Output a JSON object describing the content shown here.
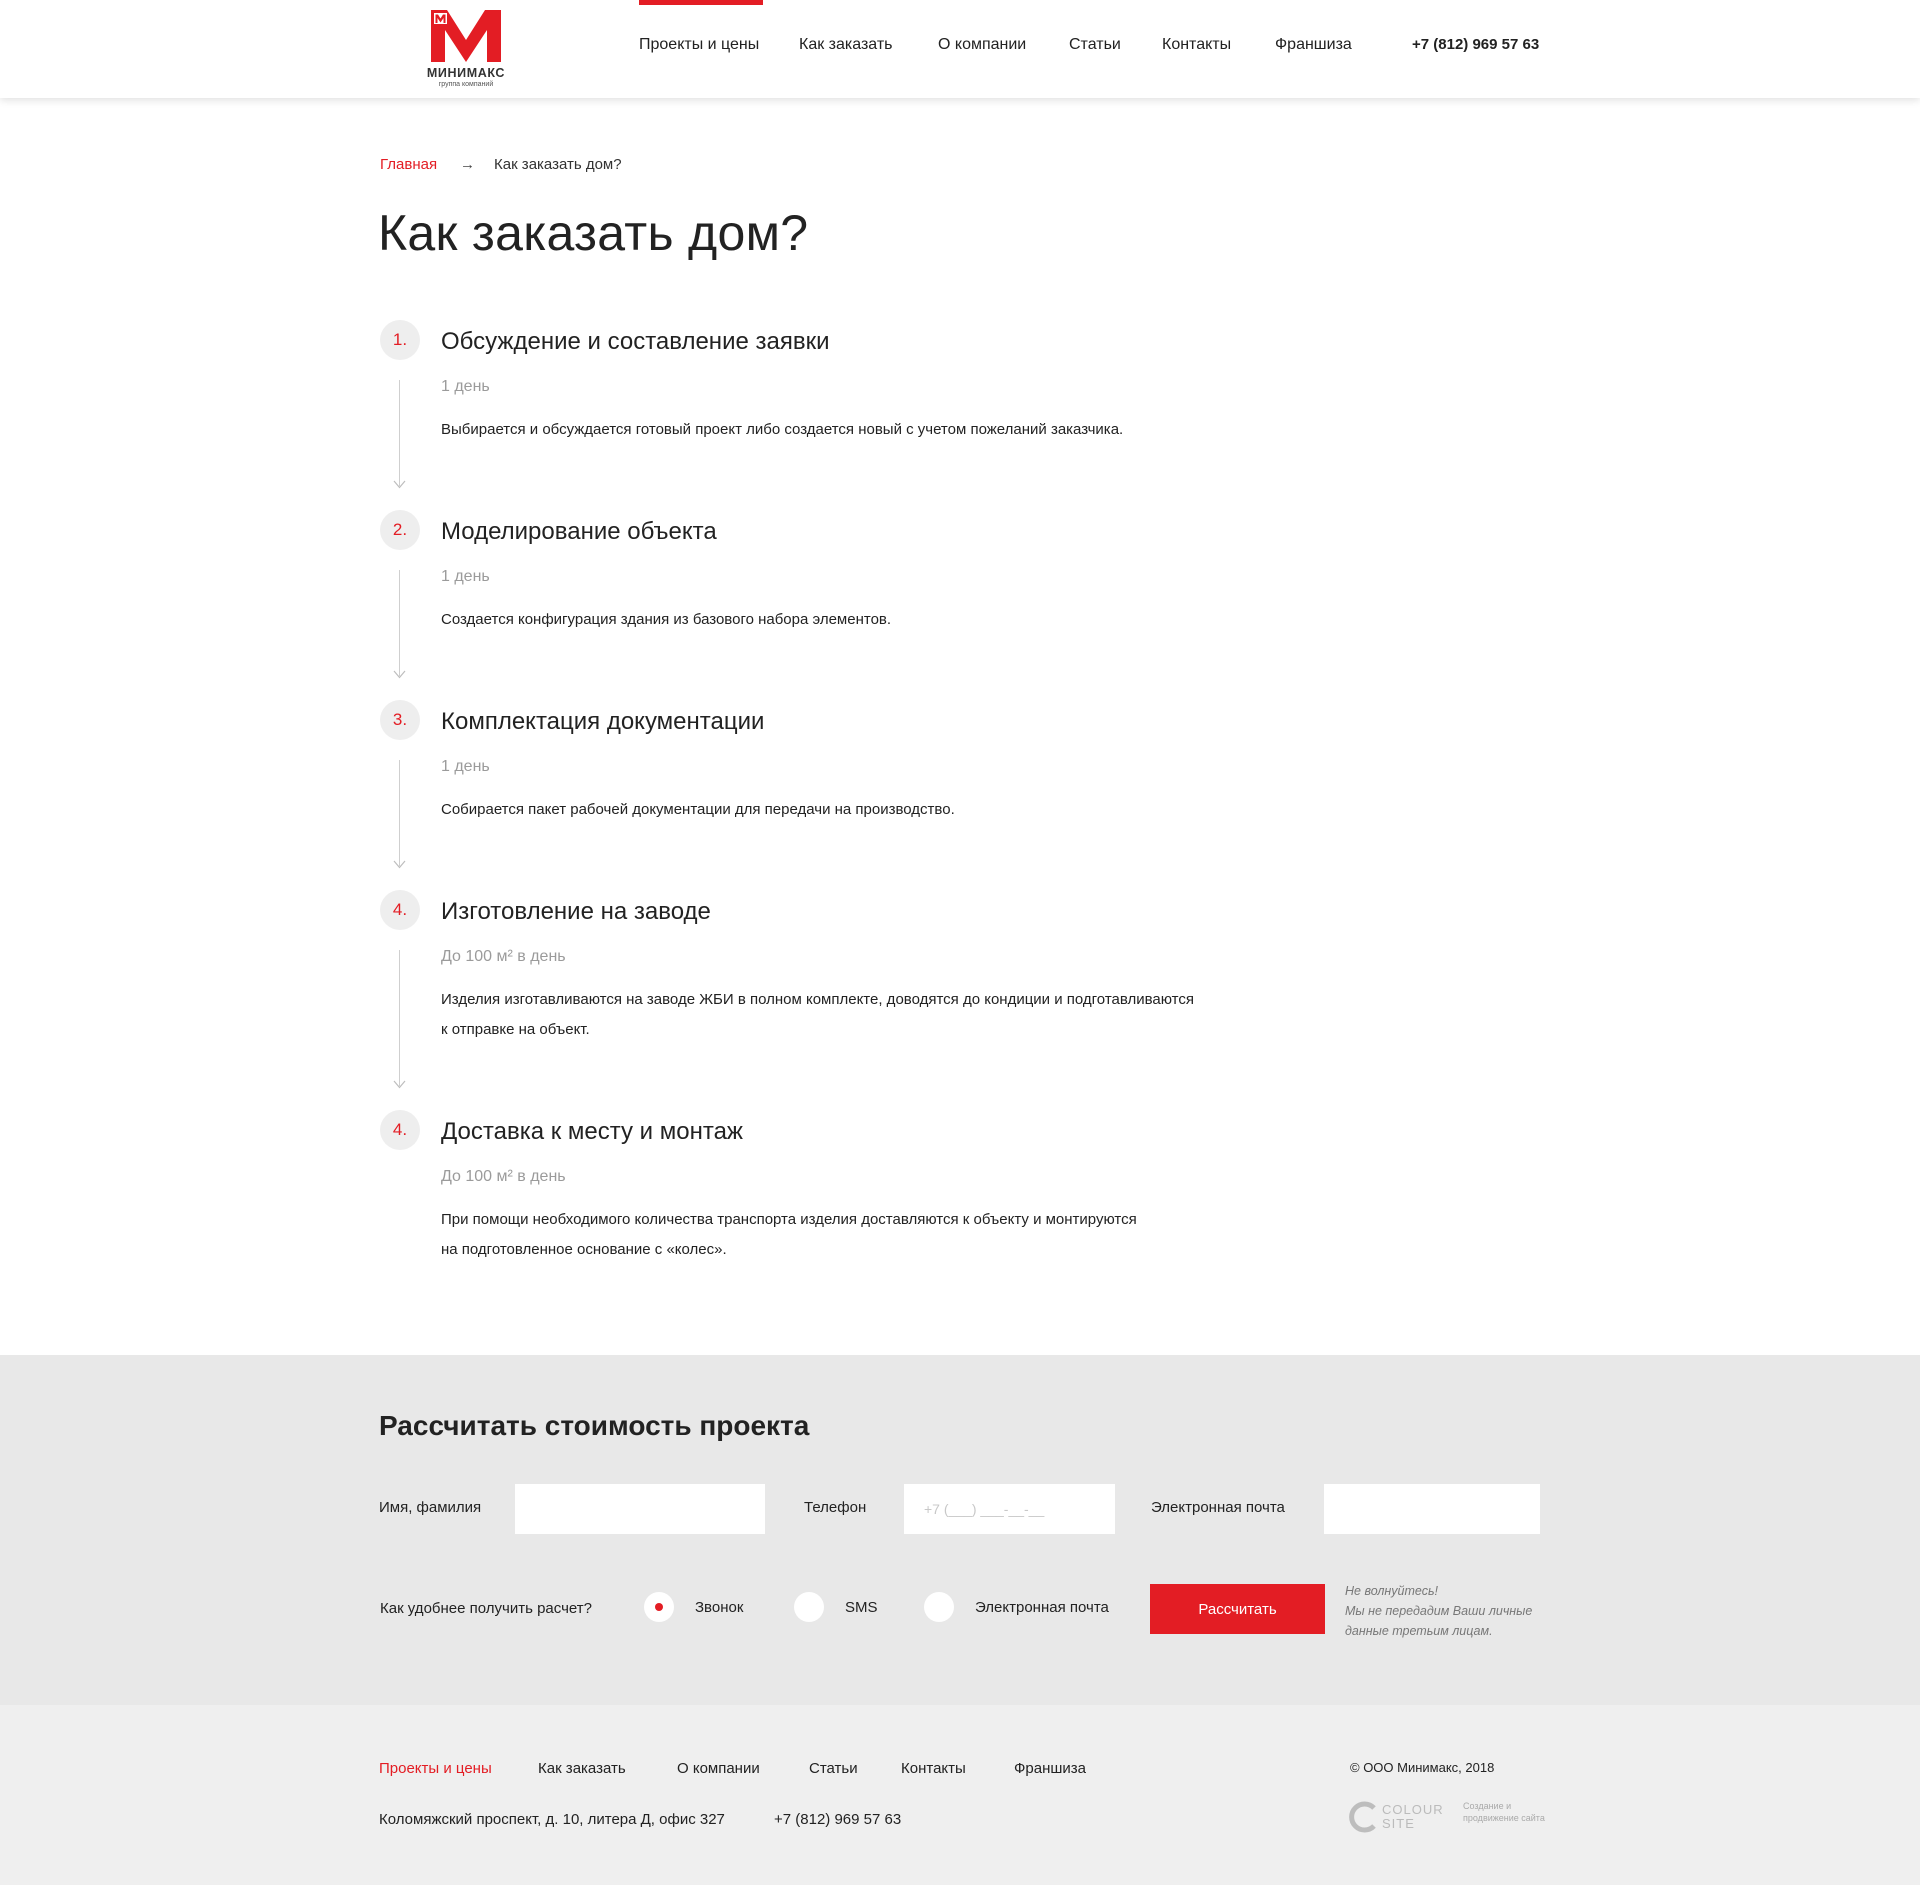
{
  "header": {
    "logo": {
      "name": "МИНИМАКС",
      "subtitle": "группа компаний"
    },
    "nav": [
      {
        "label": "Проекты и цены"
      },
      {
        "label": "Как заказать"
      },
      {
        "label": "О компании"
      },
      {
        "label": "Статьи"
      },
      {
        "label": "Контакты"
      },
      {
        "label": "Франшиза"
      }
    ],
    "phone": "+7 (812) 969 57 63"
  },
  "breadcrumb": {
    "home": "Главная",
    "separator": "→",
    "current": "Как заказать дом?"
  },
  "page_title": "Как заказать дом?",
  "steps": [
    {
      "number": "1.",
      "title": "Обсуждение и составление заявки",
      "duration": "1 день",
      "text": "Выбирается и обсуждается готовый проект либо создается новый с учетом пожеланий заказчика."
    },
    {
      "number": "2.",
      "title": "Моделирование объекта",
      "duration": "1 день",
      "text": "Создается конфигурация здания из базового набора элементов."
    },
    {
      "number": "3.",
      "title": "Комплектация документации",
      "duration": "1 день",
      "text": "Собирается пакет рабочей документации для передачи на производство."
    },
    {
      "number": "4.",
      "title": "Изготовление на заводе",
      "duration": "До 100 м² в день",
      "text_line1": "Изделия изготавливаются на заводе ЖБИ в полном комплекте, доводятся до кондиции и подготавливаются",
      "text_line2": "к отправке на объект."
    },
    {
      "number": "4.",
      "title": "Доставка к месту и монтаж",
      "duration": "До 100 м² в день",
      "text_line1": "При помощи необходимого количества транспорта изделия доставляются к объекту и монтируются",
      "text_line2": "на подготовленное основание с «колес»."
    }
  ],
  "calc": {
    "title": "Рассчитать стоимость проекта",
    "name_label": "Имя, фамилия",
    "name_value": "",
    "phone_label": "Телефон",
    "phone_placeholder": "+7 (___) ___-__-__",
    "email_label": "Электронная почта",
    "email_value": "",
    "method_label": "Как удобнее получить расчет?",
    "methods": [
      {
        "label": "Звонок",
        "checked": true
      },
      {
        "label": "SMS",
        "checked": false
      },
      {
        "label": "Электронная почта",
        "checked": false
      }
    ],
    "submit_label": "Рассчитать",
    "privacy_line1": "Не волнуйтесь!",
    "privacy_line2": "Мы не передадим Ваши личные данные третьим лицам."
  },
  "footer": {
    "nav": [
      {
        "label": "Проекты и цены"
      },
      {
        "label": "Как заказать"
      },
      {
        "label": "О компании"
      },
      {
        "label": "Статьи"
      },
      {
        "label": "Контакты"
      },
      {
        "label": "Франшиза"
      }
    ],
    "address": "Коломяжский проспект, д. 10, литера Д, офис 327",
    "phone": "+7 (812) 969 57 63",
    "copyright": "© ООО Минимакс, 2018",
    "developer": {
      "line1": "COLOUR",
      "line2": "SITE",
      "desc": "Создание и продвижение сайта"
    }
  },
  "colors": {
    "accent": "#e31d24",
    "section_bg": "#e8e8e8",
    "footer_bg": "#efefef",
    "muted": "#9b9b9b"
  },
  "icons": {
    "breadcrumb_separator": "arrow-right-icon",
    "step_connector": "arrow-down-icon",
    "developer_logo": "colour-site-logo"
  }
}
